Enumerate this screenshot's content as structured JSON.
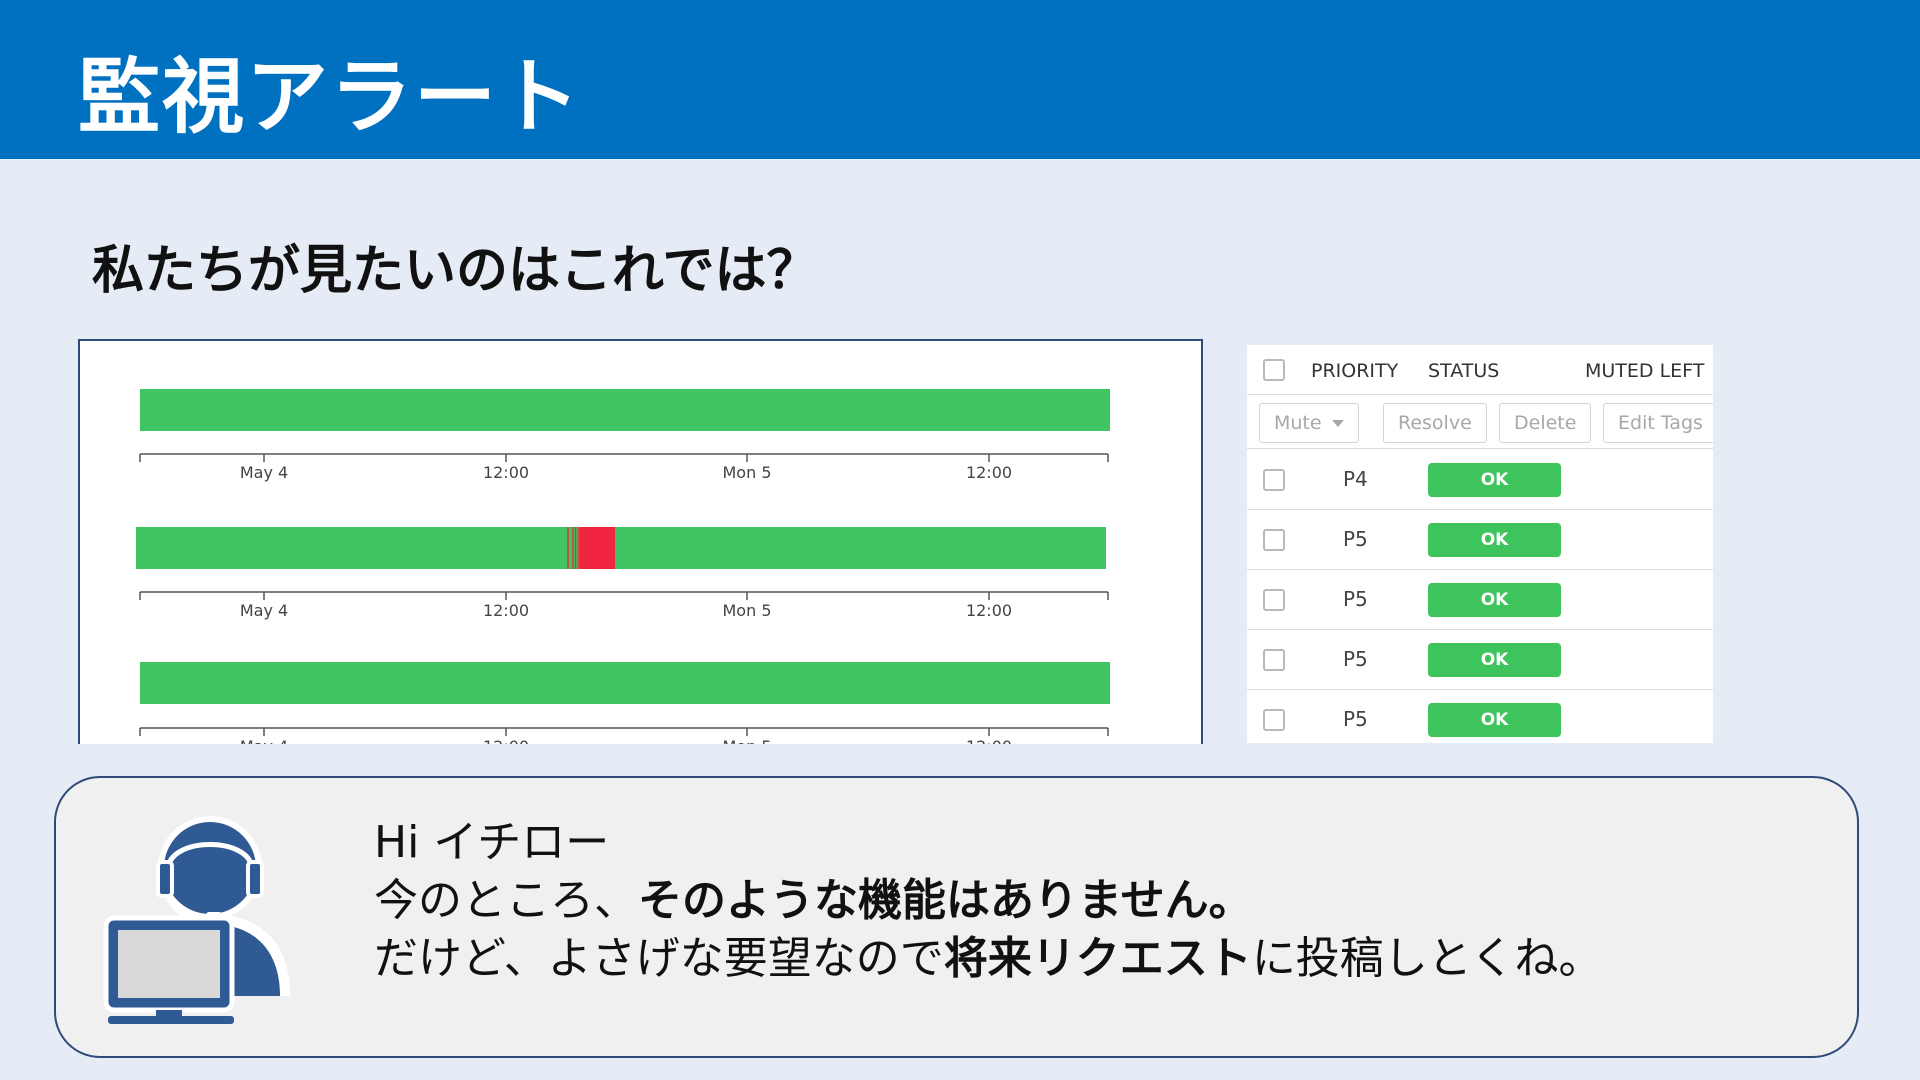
{
  "header": {
    "title": "監視アラート"
  },
  "subtitle": "私たちが見たいのはこれでは？",
  "timeline": {
    "tick_labels": [
      "May 4",
      "12:00",
      "Mon 5",
      "12:00"
    ],
    "colors": {
      "ok": "#41c464",
      "alert": "#f0243e"
    },
    "rows": [
      {
        "state": "all ok"
      },
      {
        "state": "alert window"
      },
      {
        "state": "all ok"
      }
    ]
  },
  "alert_table": {
    "columns": {
      "priority": "PRIORITY",
      "status": "STATUS",
      "muted_left": "MUTED LEFT"
    },
    "toolbar": {
      "mute": "Mute",
      "resolve": "Resolve",
      "delete": "Delete",
      "edit_tags": "Edit Tags"
    },
    "rows": [
      {
        "priority": "P4",
        "status": "OK"
      },
      {
        "priority": "P5",
        "status": "OK"
      },
      {
        "priority": "P5",
        "status": "OK"
      },
      {
        "priority": "P5",
        "status": "OK"
      },
      {
        "priority": "P5",
        "status": "OK"
      }
    ],
    "status_color": "#3ec45d"
  },
  "message": {
    "greeting": "Hi イチロー",
    "line2_prefix": "今のところ、",
    "line2_bold": "そのような機能はありません。",
    "line3_prefix": "だけど、よさげな要望なので",
    "line3_bold": "将来リクエスト",
    "line3_suffix": "に投稿しとくね。"
  },
  "colors": {
    "header_bg": "#0070c0",
    "page_bg": "#e6ecf6"
  },
  "icons": {
    "support": "headset-support-agent-icon"
  }
}
